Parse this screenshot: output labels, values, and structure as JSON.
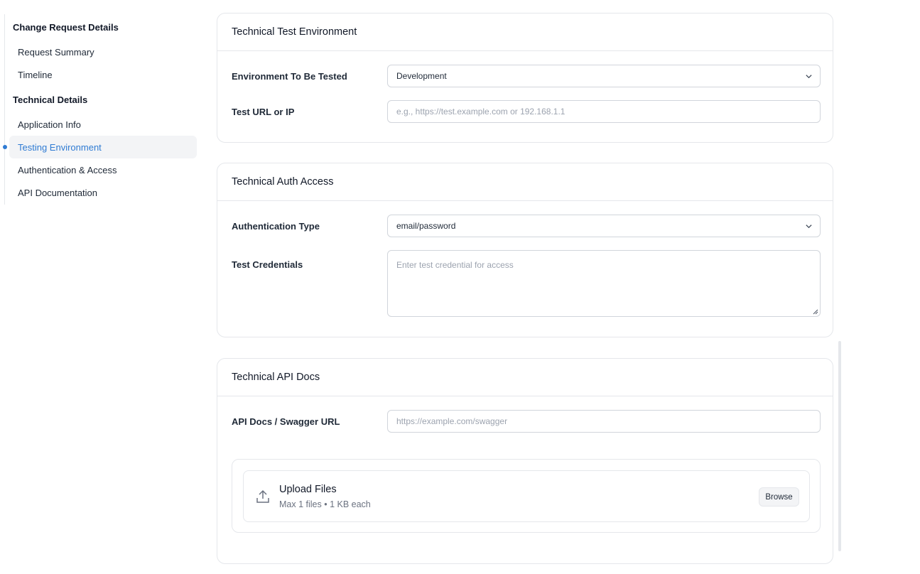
{
  "sidebar": {
    "groups": [
      {
        "label": "Change Request Details"
      },
      {
        "label": "Technical Details"
      }
    ],
    "items": [
      {
        "label": "Request Summary"
      },
      {
        "label": "Timeline"
      },
      {
        "label": "Application Info"
      },
      {
        "label": "Testing Environment",
        "active": true
      },
      {
        "label": "Authentication & Access"
      },
      {
        "label": "API Documentation"
      }
    ]
  },
  "cards": {
    "test_env": {
      "title": "Technical Test Environment",
      "environment": {
        "label": "Environment To Be Tested",
        "value": "Development"
      },
      "test_url": {
        "label": "Test URL or IP",
        "placeholder": "e.g., https://test.example.com or 192.168.1.1"
      }
    },
    "auth": {
      "title": "Technical Auth Access",
      "auth_type": {
        "label": "Authentication Type",
        "value": "email/password"
      },
      "credentials": {
        "label": "Test Credentials",
        "placeholder": "Enter test credential for access"
      }
    },
    "api_docs": {
      "title": "Technical API Docs",
      "swagger": {
        "label": "API Docs / Swagger URL",
        "placeholder": "https://example.com/swagger"
      },
      "upload": {
        "title": "Upload Files",
        "subtitle": "Max 1 files • 1 KB each",
        "browse_label": "Browse"
      }
    }
  },
  "colors": {
    "accent": "#2f7bd3",
    "border": "#e5e7eb",
    "active_bg": "#f3f4f6"
  }
}
